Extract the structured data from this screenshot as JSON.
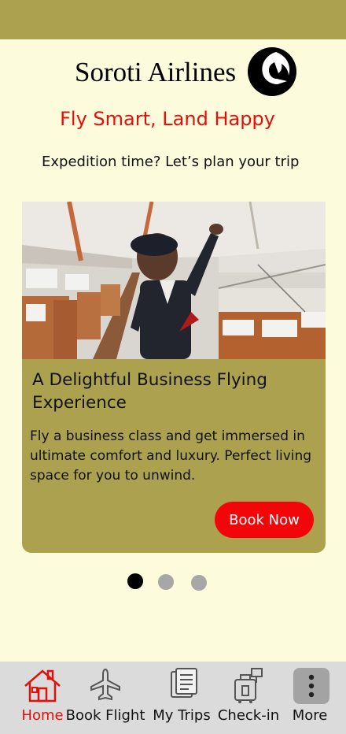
{
  "brand": {
    "name": "Soroti Airlines",
    "logo_icon": "crescent-bird-logo-icon"
  },
  "tagline": "Fly Smart, Land Happy",
  "prompt": "Expedition time? Let’s plan your trip",
  "card": {
    "image": "flight-attendant-cabin-photo",
    "title": "A Delightful Business Flying Experience",
    "body": "Fly a business class and get immersed in ultimate comfort and luxury. Perfect living space for you to unwind.",
    "cta": "Book Now"
  },
  "carousel": {
    "pages": 3,
    "active_index": 0
  },
  "bottom_nav": {
    "items": [
      {
        "label": "Home",
        "icon": "house-icon",
        "active": true
      },
      {
        "label": "Book Flight",
        "icon": "airplane-icon",
        "active": false
      },
      {
        "label": "My Trips",
        "icon": "documents-icon",
        "active": false
      },
      {
        "label": "Check-in",
        "icon": "luggage-icon",
        "active": false
      },
      {
        "label": "More",
        "icon": "more-vertical-icon",
        "active": false
      }
    ]
  },
  "colors": {
    "background": "#fcfbdc",
    "accent_olive": "#aca14f",
    "brand_red": "#e0100c",
    "button_red": "#f3060a",
    "nav_background": "#dbdbdb",
    "dot_active": "#000000",
    "dot_inactive": "#a7a7a7"
  }
}
